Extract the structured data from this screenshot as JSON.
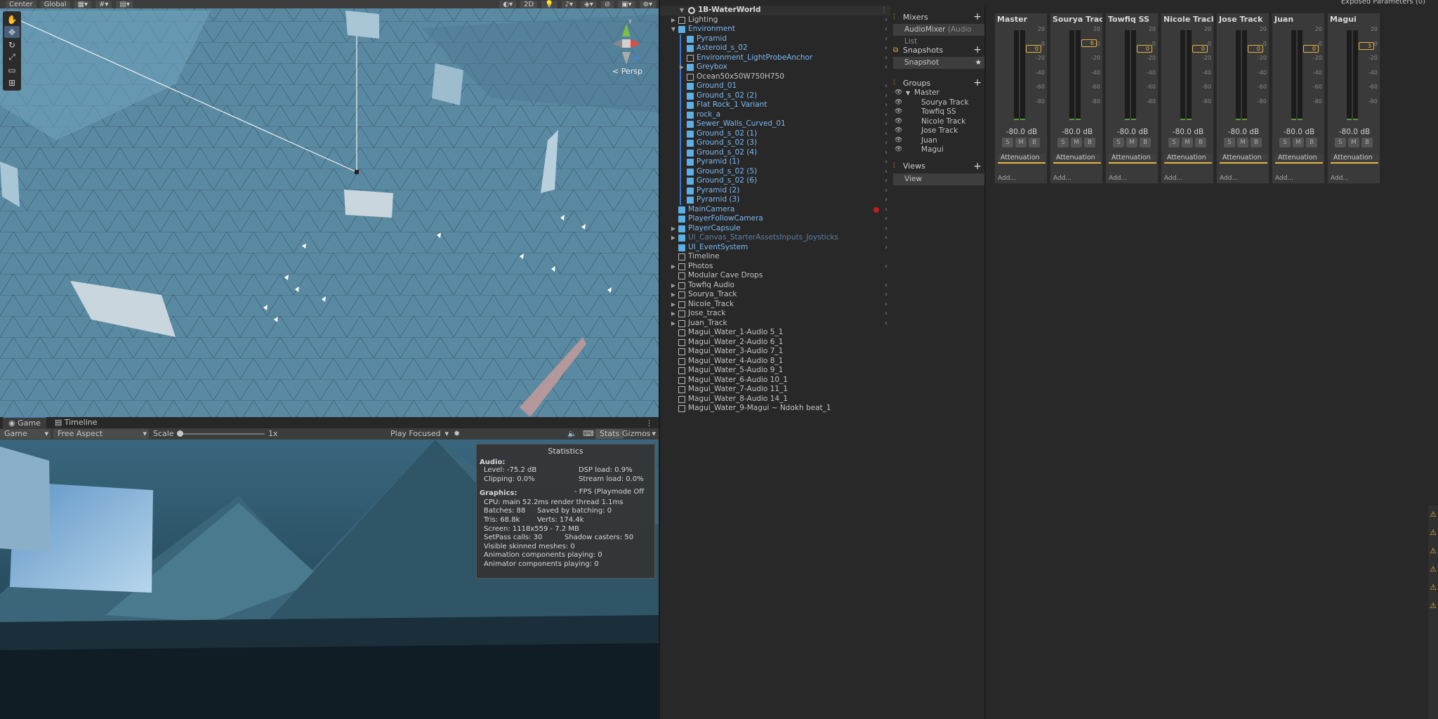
{
  "scene": {
    "toolbar": {
      "pivot": "Center",
      "space": "Global",
      "mode_2d": "2D"
    },
    "persp_label": "< Persp"
  },
  "game": {
    "tabs": [
      "Game",
      "Timeline"
    ],
    "display": "Game",
    "aspect": "Free Aspect",
    "scale_label": "Scale",
    "scale_value": "1x",
    "play_mode": "Play Focused",
    "stats_btn": "Stats",
    "gizmos_btn": "Gizmos"
  },
  "stats": {
    "title": "Statistics",
    "audio_header": "Audio:",
    "level": "Level: -75.2 dB",
    "dsp": "DSP load: 0.9%",
    "clipping": "Clipping: 0.0%",
    "stream": "Stream load: 0.0%",
    "graphics_header": "Graphics:",
    "fps": "- FPS (Playmode Off",
    "cpu": "CPU: main 52.2ms  render thread 1.1ms",
    "batches": "Batches: 88",
    "saved": "Saved by batching: 0",
    "tris": "Tris: 68.8k",
    "verts": "Verts: 174.4k",
    "screen": "Screen: 1118x559 - 7.2 MB",
    "setpass": "SetPass calls: 30",
    "shadow": "Shadow casters: 50",
    "skinned": "Visible skinned meshes: 0",
    "anim": "Animation components playing: 0",
    "animator": "Animator components playing: 0"
  },
  "hierarchy": {
    "scene_name": "1B-WaterWorld",
    "items": [
      {
        "name": "Lighting",
        "depth": 1,
        "expand": "closed",
        "style": "grey",
        "icon": "cube-grey"
      },
      {
        "name": "Environment",
        "depth": 1,
        "expand": "open",
        "style": "blue",
        "icon": "cube-blue"
      },
      {
        "name": "Pyramid",
        "depth": 2,
        "expand": "",
        "style": "blue",
        "icon": "cube-blue"
      },
      {
        "name": "Asteroid_s_02",
        "depth": 2,
        "expand": "",
        "style": "blue",
        "icon": "cube-blue"
      },
      {
        "name": "Environment_LightProbeAnchor",
        "depth": 2,
        "expand": "",
        "style": "blue",
        "icon": "cube-grey"
      },
      {
        "name": "Greybox",
        "depth": 2,
        "expand": "closed",
        "style": "blue",
        "icon": "cube-blue"
      },
      {
        "name": "Ocean50x50W750H750",
        "depth": 2,
        "expand": "",
        "style": "grey",
        "icon": "cube-grey"
      },
      {
        "name": "Ground_01",
        "depth": 2,
        "expand": "",
        "style": "blue",
        "icon": "cube-blue"
      },
      {
        "name": "Ground_s_02 (2)",
        "depth": 2,
        "expand": "",
        "style": "blue",
        "icon": "cube-blue"
      },
      {
        "name": "Flat Rock_1 Variant",
        "depth": 2,
        "expand": "",
        "style": "blue",
        "icon": "cube-blue"
      },
      {
        "name": "rock_a",
        "depth": 2,
        "expand": "",
        "style": "blue",
        "icon": "cube-blue"
      },
      {
        "name": "Sewer_Walls_Curved_01",
        "depth": 2,
        "expand": "",
        "style": "blue",
        "icon": "cube-blue"
      },
      {
        "name": "Ground_s_02 (1)",
        "depth": 2,
        "expand": "",
        "style": "blue",
        "icon": "cube-blue"
      },
      {
        "name": "Ground_s_02 (3)",
        "depth": 2,
        "expand": "",
        "style": "blue",
        "icon": "cube-blue"
      },
      {
        "name": "Ground_s_02 (4)",
        "depth": 2,
        "expand": "",
        "style": "blue",
        "icon": "cube-blue"
      },
      {
        "name": "Pyramid (1)",
        "depth": 2,
        "expand": "",
        "style": "blue",
        "icon": "cube-blue"
      },
      {
        "name": "Ground_s_02 (5)",
        "depth": 2,
        "expand": "",
        "style": "blue",
        "icon": "cube-blue"
      },
      {
        "name": "Ground_s_02 (6)",
        "depth": 2,
        "expand": "",
        "style": "blue",
        "icon": "cube-blue"
      },
      {
        "name": "Pyramid (2)",
        "depth": 2,
        "expand": "",
        "style": "blue",
        "icon": "cube-blue"
      },
      {
        "name": "Pyramid (3)",
        "depth": 2,
        "expand": "",
        "style": "blue",
        "icon": "cube-blue"
      },
      {
        "name": "MainCamera",
        "depth": 1,
        "expand": "",
        "style": "blue",
        "icon": "cube-blue"
      },
      {
        "name": "PlayerFollowCamera",
        "depth": 1,
        "expand": "",
        "style": "blue",
        "icon": "cube-blue"
      },
      {
        "name": "PlayerCapsule",
        "depth": 1,
        "expand": "closed",
        "style": "blue",
        "icon": "cube-blue"
      },
      {
        "name": "UI_Canvas_StarterAssetsInputs_Joysticks",
        "depth": 1,
        "expand": "closed",
        "style": "faded",
        "icon": "cube-blue"
      },
      {
        "name": "UI_EventSystem",
        "depth": 1,
        "expand": "",
        "style": "blue",
        "icon": "cube-blue"
      },
      {
        "name": "Timeline",
        "depth": 1,
        "expand": "",
        "style": "grey",
        "icon": "cube-grey"
      },
      {
        "name": "Photos",
        "depth": 1,
        "expand": "closed",
        "style": "grey",
        "icon": "cube-grey"
      },
      {
        "name": "Modular Cave Drops",
        "depth": 1,
        "expand": "",
        "style": "grey",
        "icon": "cube-grey"
      },
      {
        "name": "Towfiq Audio",
        "depth": 1,
        "expand": "closed",
        "style": "grey",
        "icon": "cube-grey"
      },
      {
        "name": "Sourya_Track",
        "depth": 1,
        "expand": "closed",
        "style": "grey",
        "icon": "cube-grey"
      },
      {
        "name": "Nicole_Track",
        "depth": 1,
        "expand": "closed",
        "style": "grey",
        "icon": "cube-grey"
      },
      {
        "name": "Jose_track",
        "depth": 1,
        "expand": "closed",
        "style": "grey",
        "icon": "cube-grey"
      },
      {
        "name": "Juan_Track",
        "depth": 1,
        "expand": "closed",
        "style": "grey",
        "icon": "cube-grey"
      },
      {
        "name": "Magui_Water_1-Audio 5_1",
        "depth": 1,
        "expand": "",
        "style": "grey",
        "icon": "cube-grey"
      },
      {
        "name": "Magui_Water_2-Audio 6_1",
        "depth": 1,
        "expand": "",
        "style": "grey",
        "icon": "cube-grey"
      },
      {
        "name": "Magui_Water_3-Audio 7_1",
        "depth": 1,
        "expand": "",
        "style": "grey",
        "icon": "cube-grey"
      },
      {
        "name": "Magui_Water_4-Audio 8_1",
        "depth": 1,
        "expand": "",
        "style": "grey",
        "icon": "cube-grey"
      },
      {
        "name": "Magui_Water_5-Audio 9_1",
        "depth": 1,
        "expand": "",
        "style": "grey",
        "icon": "cube-grey"
      },
      {
        "name": "Magui_Water_6-Audio 10_1",
        "depth": 1,
        "expand": "",
        "style": "grey",
        "icon": "cube-grey"
      },
      {
        "name": "Magui_Water_7-Audio 11_1",
        "depth": 1,
        "expand": "",
        "style": "grey",
        "icon": "cube-grey"
      },
      {
        "name": "Magui_Water_8-Audio 14_1",
        "depth": 1,
        "expand": "",
        "style": "grey",
        "icon": "cube-grey"
      },
      {
        "name": "Magui_Water_9-Magui ~ Ndokh beat_1",
        "depth": 1,
        "expand": "",
        "style": "grey",
        "icon": "cube-grey"
      }
    ]
  },
  "mixer": {
    "exposed_params": "Exposed Parameters (0)",
    "mixers_label": "Mixers",
    "mixer_item": "AudioMixer",
    "mixer_item_suffix": "(Audio List",
    "snapshots_label": "Snapshots",
    "snapshot_item": "Snapshot",
    "groups_label": "Groups",
    "groups": [
      "Master",
      "Sourya Track",
      "Towfiq SS",
      "Nicole Track",
      "Jose Track",
      "Juan",
      "Magui"
    ],
    "views_label": "Views",
    "view_item": "View",
    "scale_ticks": [
      "20",
      "0",
      "-20",
      "-40",
      "-60",
      "-80"
    ],
    "attenuation": "Attenuation",
    "add": "Add...",
    "smb": [
      "S",
      "M",
      "B"
    ],
    "strips": [
      {
        "name": "Master",
        "db": "-80.0 dB",
        "fader": "0",
        "fader_db": 0
      },
      {
        "name": "Sourya Track",
        "db": "-80.0 dB",
        "fader": "6",
        "fader_db": 6
      },
      {
        "name": "Towfiq SS",
        "db": "-80.0 dB",
        "fader": "0",
        "fader_db": 0
      },
      {
        "name": "Nicole Track",
        "db": "-80.0 dB",
        "fader": "0",
        "fader_db": 0
      },
      {
        "name": "Jose Track",
        "db": "-80.0 dB",
        "fader": "0",
        "fader_db": 0
      },
      {
        "name": "Juan",
        "db": "-80.0 dB",
        "fader": "0",
        "fader_db": 0
      },
      {
        "name": "Magui",
        "db": "-80.0 dB",
        "fader": "3",
        "fader_db": 3
      }
    ]
  }
}
